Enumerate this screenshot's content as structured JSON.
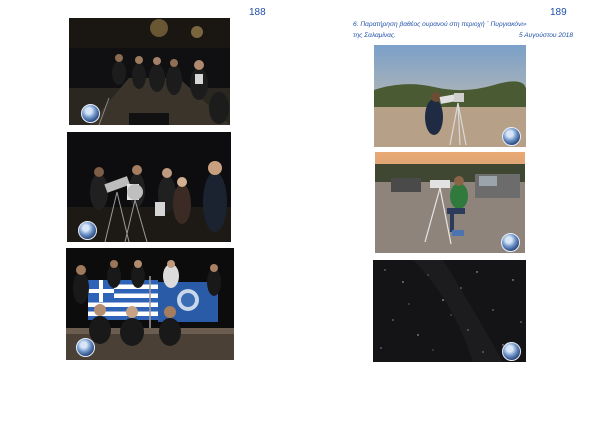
{
  "pages": {
    "left": {
      "number": "188"
    },
    "right": {
      "number": "189",
      "caption_line1": "6.  Παρατήρηση βαθέος ουρανού στη περιοχή ¨ Πυργιακόνι»",
      "caption_line2": "της Σαλαμίνας.",
      "caption_date": "5 Αυγούστου 2018"
    }
  },
  "photos": [
    {
      "id": "night-street-observers",
      "badge": "club-logo-icon"
    },
    {
      "id": "night-telescope-group",
      "badge": "club-logo-icon"
    },
    {
      "id": "group-with-flags",
      "badge": "club-logo-icon"
    },
    {
      "id": "man-at-telescope-dusk",
      "badge": "club-logo-icon"
    },
    {
      "id": "seated-man-with-telescope",
      "badge": "club-logo-icon"
    },
    {
      "id": "starry-sky",
      "badge": "club-logo-icon"
    }
  ]
}
